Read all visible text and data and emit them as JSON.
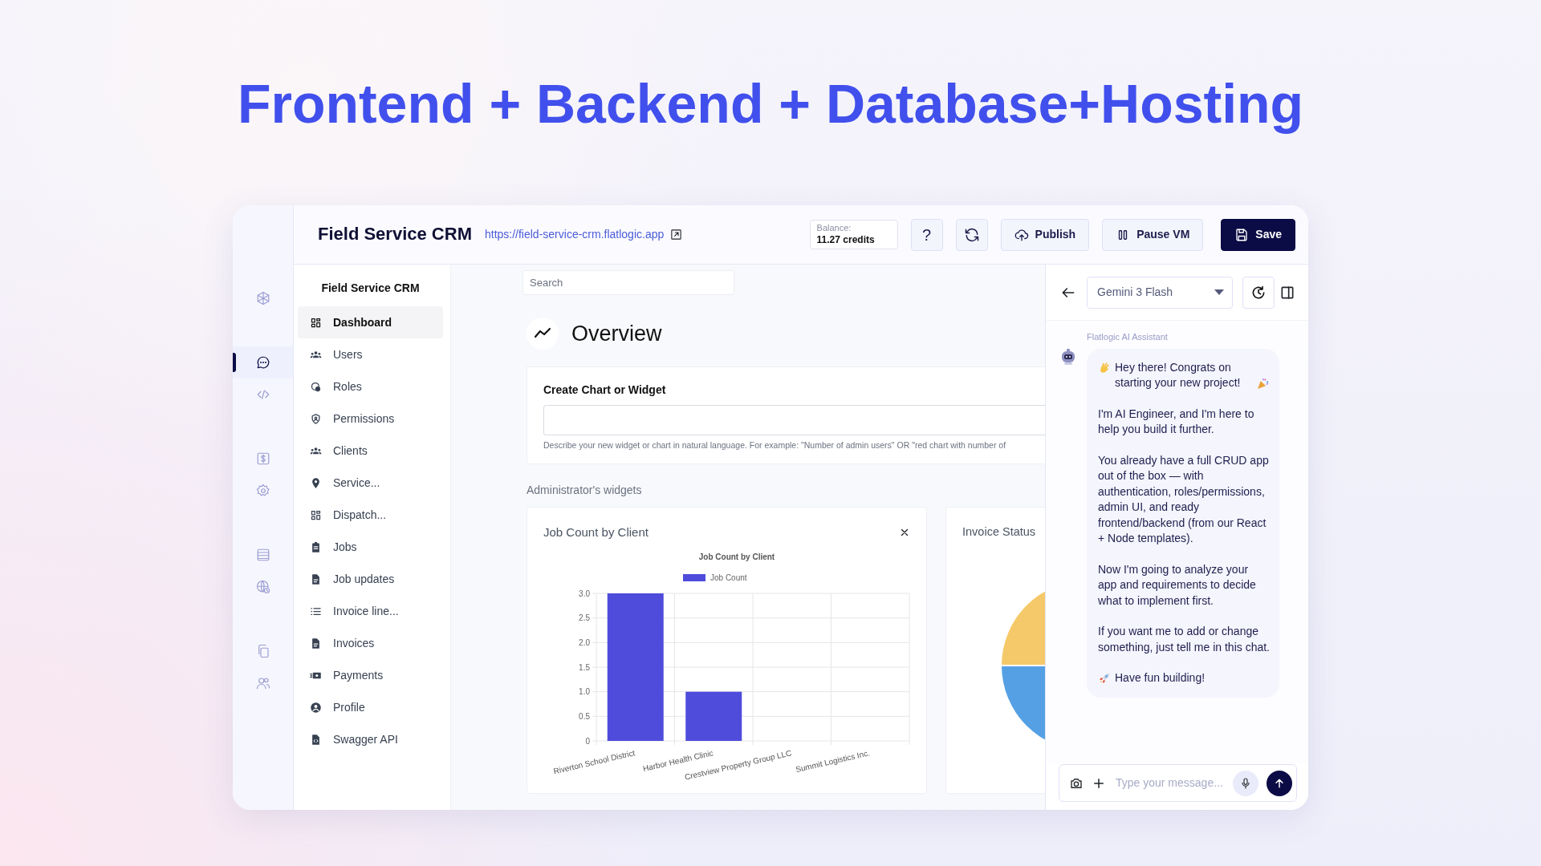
{
  "headline": "Frontend + Backend + Database+Hosting",
  "app": {
    "title": "Field Service CRM",
    "url": "https://field-service-crm.flatlogic.app",
    "balance_label": "Balance:",
    "balance_value": "11.27 credits",
    "help_label": "?",
    "buttons": [
      {
        "label": "Publish",
        "kind": "outline"
      },
      {
        "label": "Pause VM",
        "kind": "outline"
      },
      {
        "label": "Save",
        "kind": "primary"
      }
    ]
  },
  "rail": [
    [
      {
        "selected": false
      }
    ],
    [
      {
        "selected": true
      },
      {
        "selected": false
      }
    ],
    [
      {
        "selected": false
      },
      {
        "selected": false
      }
    ],
    [
      {
        "selected": false
      },
      {
        "selected": false
      }
    ],
    [
      {
        "selected": false
      },
      {
        "selected": false
      }
    ]
  ],
  "sidebar": {
    "title": "Field Service CRM",
    "items": [
      {
        "label": "Dashboard",
        "selected": true
      },
      {
        "label": "Users",
        "selected": false
      },
      {
        "label": "Roles",
        "selected": false
      },
      {
        "label": "Permissions",
        "selected": false
      },
      {
        "label": "Clients",
        "selected": false
      },
      {
        "label": "Service...",
        "selected": false
      },
      {
        "label": "Dispatch...",
        "selected": false
      },
      {
        "label": "Jobs",
        "selected": false
      },
      {
        "label": "Job updates",
        "selected": false
      },
      {
        "label": "Invoice line...",
        "selected": false
      },
      {
        "label": "Invoices",
        "selected": false
      },
      {
        "label": "Payments",
        "selected": false
      },
      {
        "label": "Profile",
        "selected": false
      },
      {
        "label": "Swagger API",
        "selected": false
      }
    ]
  },
  "main": {
    "search": {
      "placeholder": "Search"
    },
    "heading": "Overview",
    "create_widget": {
      "title": "Create Chart or Widget",
      "hint": "Describe your new widget or chart in natural language. For example: \"Number of admin users\" OR \"red chart with number of"
    },
    "widgets_label": "Administrator's widgets",
    "widgets": [
      {
        "kind": "bar_chart",
        "title": "Job Count by Client",
        "chart_data": {
          "type": "bar",
          "title": "Job Count by Client",
          "categories": [
            "Riverton School District",
            "Harbor Health Clinic",
            "Crestview Property Group LLC",
            "Summit Logistics Inc."
          ],
          "series": [
            {
              "name": "Job Count",
              "color": "#4f4cdc",
              "values": [
                3,
                1,
                0,
                0
              ]
            }
          ],
          "grid": true,
          "ylim": [
            0,
            3
          ],
          "yticks": [
            {
              "value": 0,
              "label": "0"
            },
            {
              "value": 0.5,
              "label": "0.5"
            },
            {
              "value": 1,
              "label": "1.0"
            },
            {
              "value": 1.5,
              "label": "1.5"
            },
            {
              "value": 2,
              "label": "2.0"
            },
            {
              "value": 2.5,
              "label": "2.5"
            },
            {
              "value": 3,
              "label": "3.0"
            }
          ]
        }
      },
      {
        "kind": "pie_picture",
        "title": "Invoice Status"
      }
    ]
  },
  "chat": {
    "model": "Gemini 3 Flash",
    "sender": "Flatlogic AI Assistant",
    "paragraphs": [
      {
        "kind": "greeting",
        "text": "Hey there! Congrats on starting your new project!"
      },
      {
        "kind": "plain",
        "text": "I'm AI Engineer, and I'm here to help you build it further."
      },
      {
        "kind": "plain",
        "text": "You already have a full CRUD app out of the box — with authentication, roles/permissions, admin UI, and ready frontend/backend (from our React + Node templates)."
      },
      {
        "kind": "plain",
        "text": "Now I'm going to analyze your app and requirements to decide what to implement first."
      },
      {
        "kind": "plain",
        "text": "If you want me to add or change something, just tell me in this chat."
      },
      {
        "kind": "signoff",
        "text": "Have fun building!"
      }
    ],
    "input": {
      "placeholder": "Type your message..."
    }
  }
}
